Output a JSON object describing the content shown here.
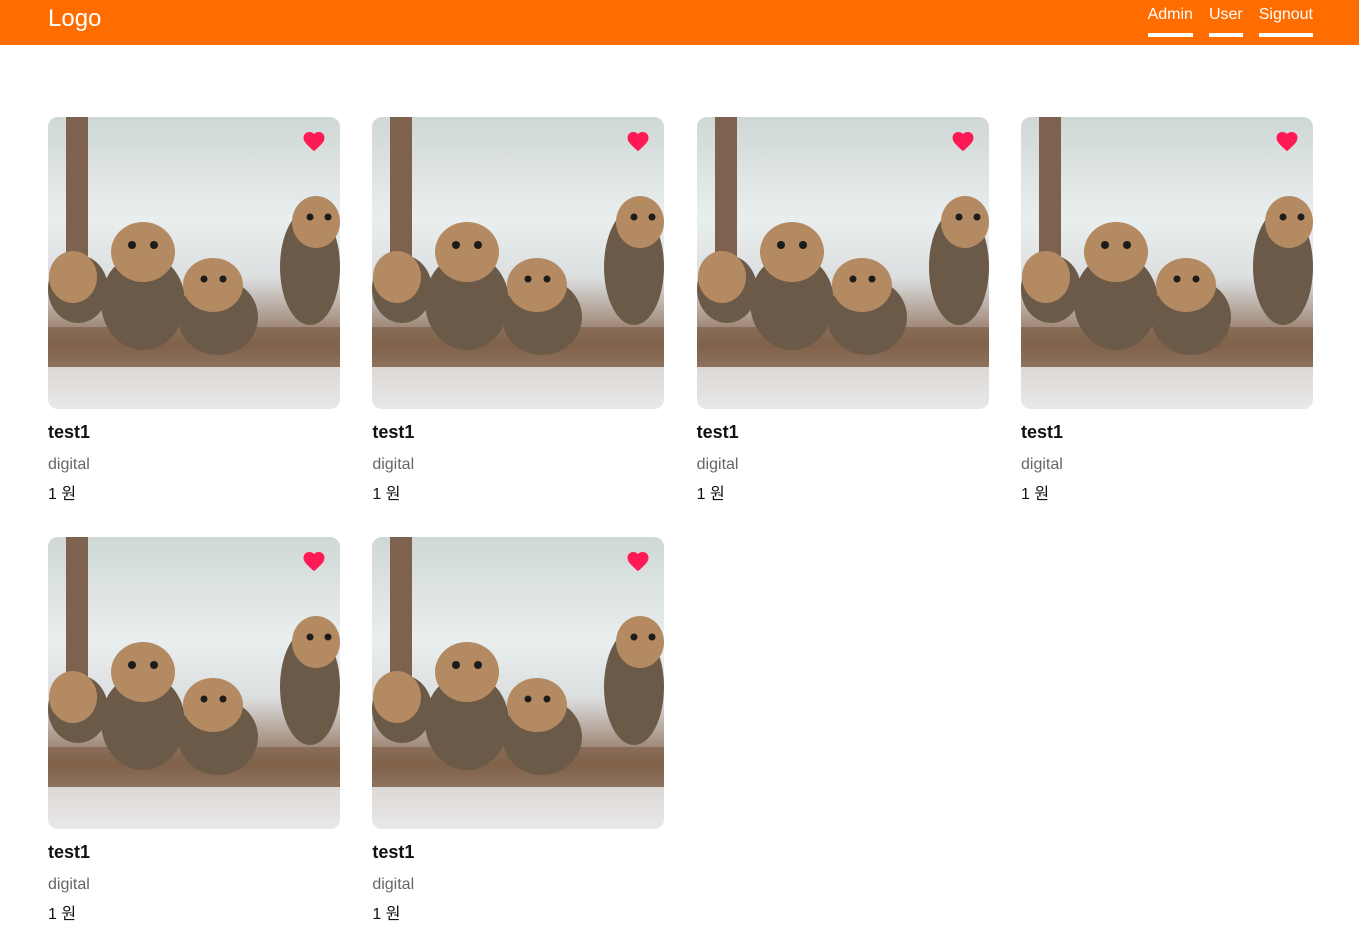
{
  "header": {
    "logo": "Logo",
    "nav": [
      {
        "label": "Admin"
      },
      {
        "label": "User"
      },
      {
        "label": "Signout"
      }
    ],
    "bg_color": "#ff6c00"
  },
  "products": [
    {
      "title": "test1",
      "category": "digital",
      "price": "1",
      "currency": "원",
      "liked": true,
      "image": "kittens-photo"
    },
    {
      "title": "test1",
      "category": "digital",
      "price": "1",
      "currency": "원",
      "liked": true,
      "image": "kittens-photo"
    },
    {
      "title": "test1",
      "category": "digital",
      "price": "1",
      "currency": "원",
      "liked": true,
      "image": "kittens-photo"
    },
    {
      "title": "test1",
      "category": "digital",
      "price": "1",
      "currency": "원",
      "liked": true,
      "image": "kittens-photo"
    },
    {
      "title": "test1",
      "category": "digital",
      "price": "1",
      "currency": "원",
      "liked": true,
      "image": "kittens-photo"
    },
    {
      "title": "test1",
      "category": "digital",
      "price": "1",
      "currency": "원",
      "liked": true,
      "image": "kittens-photo"
    }
  ],
  "heart_color": "#ff1a55"
}
